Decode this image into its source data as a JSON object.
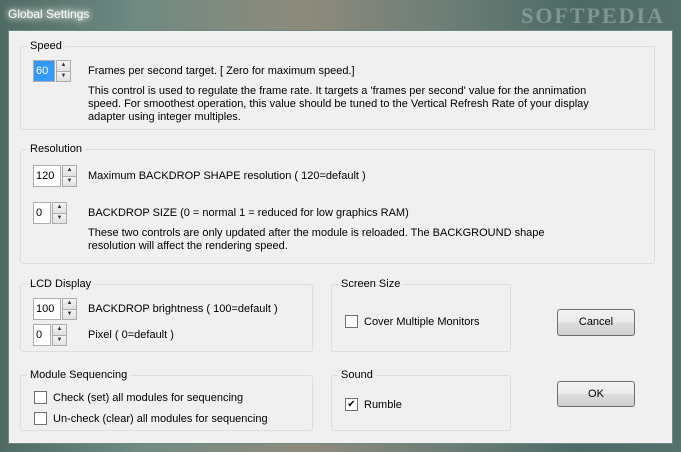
{
  "window": {
    "title": "Global Settings",
    "watermark": "SOFTPEDIA"
  },
  "speed": {
    "legend": "Speed",
    "fps_value": "60",
    "fps_label": "Frames per second target.  [ Zero for maximum speed.]",
    "description": "This control is used to regulate the frame rate.  It targets a 'frames per second' value for the annimation speed.  For smoothest operation, this value should be tuned to the Vertical Refresh Rate of your display adapter using integer multiples."
  },
  "resolution": {
    "legend": "Resolution",
    "shape_value": "120",
    "shape_label": "Maximum BACKDROP SHAPE resolution ( 120=default )",
    "size_value": "0",
    "size_label": "BACKDROP SIZE  (0 = normal    1 = reduced for low graphics RAM)",
    "description": "These two controls are only updated after the module is reloaded.  The BACKGROUND shape resolution will affect the rendering speed."
  },
  "lcd": {
    "legend": "LCD Display",
    "brightness_value": "100",
    "brightness_label": "BACKDROP brightness ( 100=default )",
    "pixel_value": "0",
    "pixel_label": "Pixel ( 0=default )"
  },
  "screen_size": {
    "legend": "Screen Size",
    "cover_label": "Cover Multiple Monitors",
    "cover_checked": false
  },
  "sequencing": {
    "legend": "Module Sequencing",
    "check_all_label": "Check (set) all modules for sequencing",
    "uncheck_all_label": "Un-check (clear) all modules for sequencing"
  },
  "sound": {
    "legend": "Sound",
    "rumble_label": "Rumble",
    "rumble_checked": true,
    "check_glyph": "✔"
  },
  "buttons": {
    "cancel": "Cancel",
    "ok": "OK"
  },
  "spin_arrows": {
    "up": "▲",
    "down": "▼"
  }
}
